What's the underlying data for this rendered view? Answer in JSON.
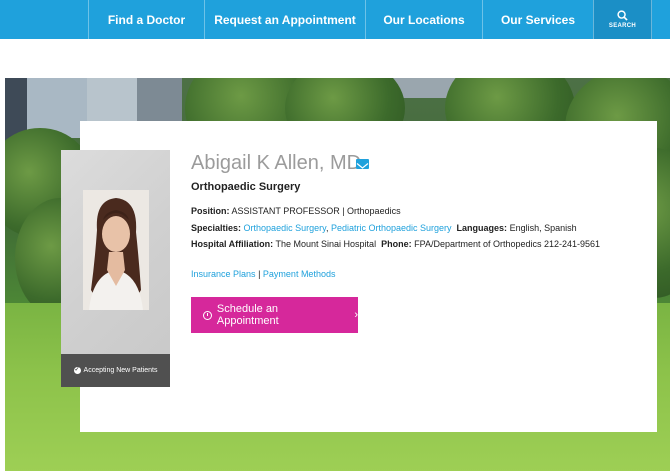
{
  "nav": {
    "items": [
      {
        "label": "Find a Doctor"
      },
      {
        "label": "Request an Appointment"
      },
      {
        "label": "Our Locations"
      },
      {
        "label": "Our Services"
      }
    ],
    "search_label": "SEARCH",
    "search_icon": "search-icon"
  },
  "doctor": {
    "name": "Abigail K Allen, MD",
    "specialty_title": "Orthopaedic Surgery",
    "position_label": "Position:",
    "position_value": "ASSISTANT PROFESSOR | Orthopaedics",
    "specialties_label": "Specialties:",
    "specialties": [
      "Orthopaedic Surgery",
      "Pediatric Orthopaedic Surgery"
    ],
    "languages_label": "Languages:",
    "languages_value": "English,  Spanish",
    "affiliation_label": "Hospital Affiliation:",
    "affiliation_value": "The Mount Sinai Hospital",
    "phone_label": "Phone:",
    "phone_value": "FPA/Department of Orthopedics 212-241-9561",
    "accepting": "Accepting New Patients"
  },
  "links": {
    "insurance": "Insurance Plans",
    "separator": "|",
    "payment": "Payment Methods"
  },
  "cta": {
    "label": "Schedule an Appointment",
    "chevron": "›"
  },
  "colors": {
    "nav_bg": "#1fa1dc",
    "link": "#1fa1dc",
    "cta_bg": "#d6289b",
    "name_gray": "#9b9b9b"
  }
}
